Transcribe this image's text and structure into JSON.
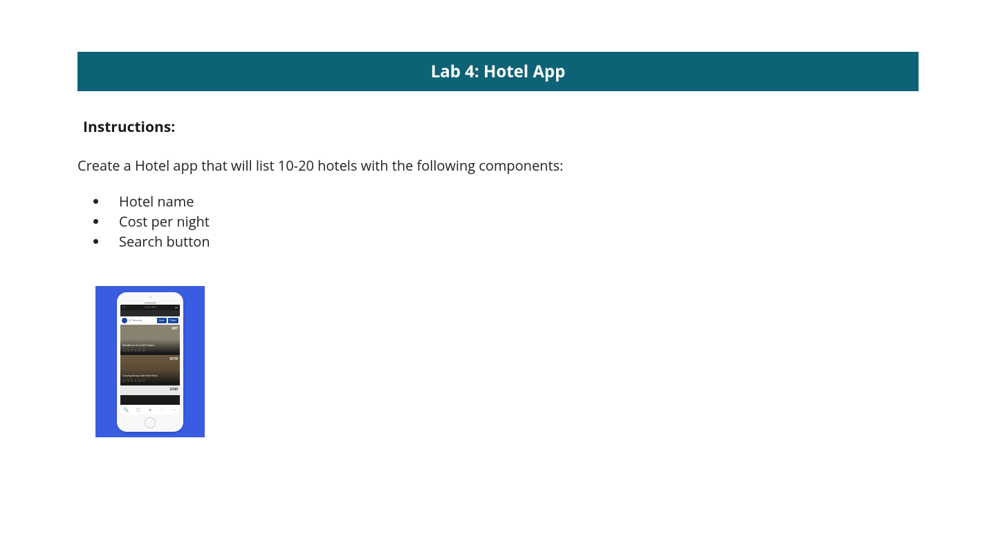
{
  "header": {
    "title": "Lab 4: Hotel App"
  },
  "instructions": {
    "heading": "Instructions:",
    "intro": "Create a Hotel app that will list 10-20 hotels with the following components:",
    "bullets": [
      "Hotel name",
      "Cost per night",
      " Search button"
    ]
  },
  "mockup": {
    "status_time": "12:35 PM",
    "filter_text": "47 Results",
    "filter_btn_sort": "Sort",
    "filter_btn_filter": "Filter",
    "hotels": [
      {
        "price": "$97",
        "name": "Residence & Suite Palace"
      },
      {
        "price": "$119",
        "name": "Courtyard by Marriott Paris"
      },
      {
        "price": "$100",
        "name": ""
      }
    ]
  }
}
